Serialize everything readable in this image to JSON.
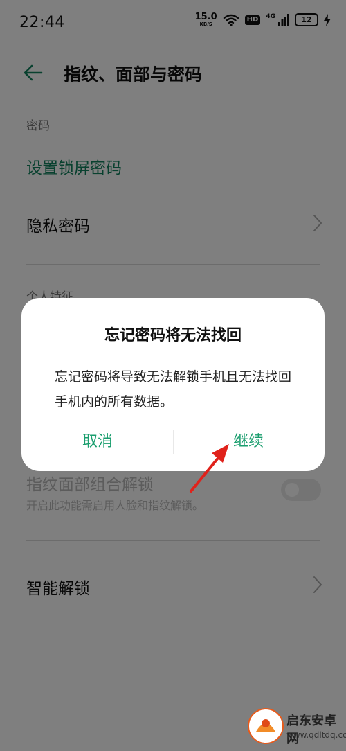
{
  "status_bar": {
    "time": "22:44",
    "net_speed_value": "15.0",
    "net_speed_unit": "KB/S",
    "hd_badge": "HD",
    "network_type": "4G",
    "battery_level": "12",
    "icons": [
      "wifi-icon",
      "signal-icon",
      "battery-icon",
      "charging-bolt-icon"
    ]
  },
  "header": {
    "title": "指纹、面部与密码",
    "back_icon": "arrow-left-icon"
  },
  "sections": {
    "password_label": "密码",
    "personal_label": "个人特征"
  },
  "settings": {
    "set_lock_password": "设置锁屏密码",
    "privacy_password": "隐私密码",
    "combo_unlock_title": "指纹面部组合解锁",
    "combo_unlock_subtitle": "开启此功能需启用人脸和指纹解锁。",
    "smart_unlock": "智能解锁",
    "combo_unlock_enabled": false
  },
  "dialog": {
    "title": "忘记密码将无法找回",
    "message": "忘记密码将导致无法解锁手机且无法找回手机内的所有数据。",
    "cancel_label": "取消",
    "continue_label": "继续"
  },
  "watermark": {
    "title": "启东安卓网",
    "url": "www.qdltdq.com"
  },
  "colors": {
    "accent": "#1a9e6e",
    "accent_dark": "#13835f",
    "annotation_arrow": "#e0221b"
  }
}
